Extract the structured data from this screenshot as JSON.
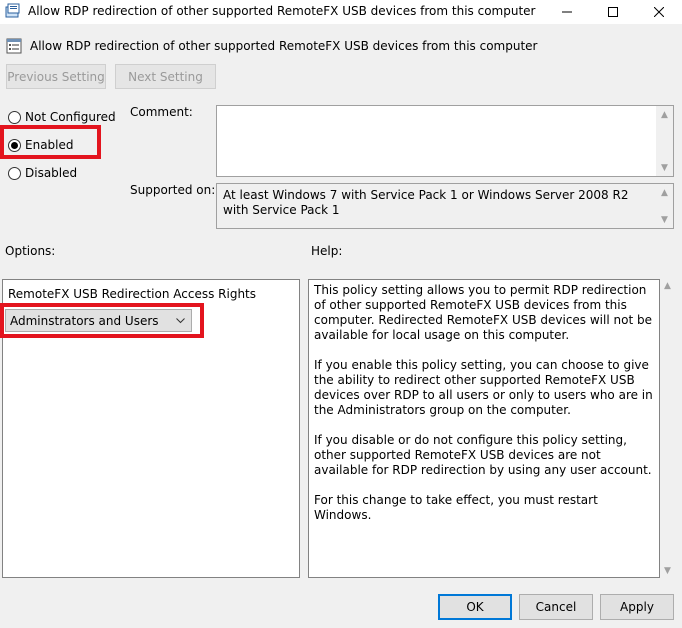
{
  "window": {
    "title": "Allow RDP redirection of other supported RemoteFX USB devices from this computer",
    "icons": {
      "app": "policy-icon",
      "minimize": "minimize-icon",
      "maximize": "maximize-icon",
      "close": "close-icon"
    }
  },
  "header": {
    "title": "Allow RDP redirection of other supported RemoteFX USB devices from this computer",
    "icon": "policy-setting-icon"
  },
  "nav": {
    "previous_label": "Previous Setting",
    "next_label": "Next Setting"
  },
  "state": {
    "options": [
      {
        "label": "Not Configured",
        "selected": false
      },
      {
        "label": "Enabled",
        "selected": true
      },
      {
        "label": "Disabled",
        "selected": false
      }
    ]
  },
  "comment": {
    "label": "Comment:",
    "value": ""
  },
  "supported": {
    "label": "Supported on:",
    "value": "At least Windows 7 with Service Pack 1 or Windows Server 2008 R2 with Service Pack 1"
  },
  "options_section": {
    "label": "Options:",
    "field_label": "RemoteFX USB Redirection Access Rights",
    "dropdown_value": "Adminstrators and Users"
  },
  "help": {
    "label": "Help:",
    "paragraphs": [
      "This policy setting allows you to permit RDP redirection of other supported RemoteFX USB devices from this computer. Redirected RemoteFX USB devices will not be available for local usage on this computer.",
      "If you enable this policy setting, you can choose to give the ability to redirect other supported RemoteFX USB devices over RDP to all users or only to users who are in the Administrators group on the computer.",
      "If you disable or do not configure this policy setting, other supported RemoteFX USB devices are not available for RDP redirection by using any user account.",
      "For this change to take effect, you must restart Windows."
    ]
  },
  "buttons": {
    "ok": "OK",
    "cancel": "Cancel",
    "apply": "Apply"
  },
  "colors": {
    "highlight": "#e3141e",
    "default_button_border": "#0078d7",
    "window_bg": "#f0f0f0"
  }
}
